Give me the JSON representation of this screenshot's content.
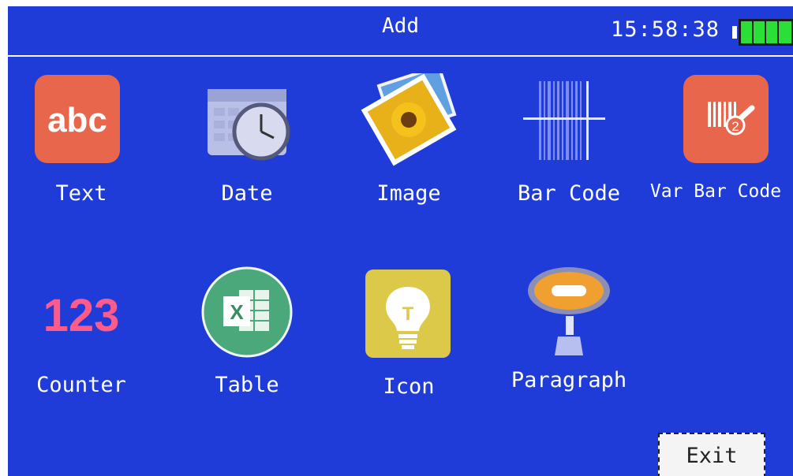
{
  "header": {
    "title": "Add",
    "time": "15:58:38",
    "battery_level": 1.0
  },
  "tiles": [
    {
      "label": "Text",
      "icon": "text-icon",
      "glyph": "abc"
    },
    {
      "label": "Date",
      "icon": "date-icon"
    },
    {
      "label": "Image",
      "icon": "image-icon"
    },
    {
      "label": "Bar Code",
      "icon": "barcode-icon"
    },
    {
      "label": "Var Bar Code",
      "icon": "var-barcode-icon",
      "glyph": "2"
    },
    {
      "label": "Counter",
      "icon": "counter-icon",
      "glyph": "123"
    },
    {
      "label": "Table",
      "icon": "table-icon",
      "glyph": "X"
    },
    {
      "label": "Icon",
      "icon": "lightbulb-icon",
      "glyph": "T"
    },
    {
      "label": "Paragraph",
      "icon": "paragraph-icon"
    }
  ],
  "footer": {
    "exit_label": "Exit"
  },
  "colors": {
    "background": "#1f3cd8",
    "battery": "#2cdf37",
    "text_icon": "#e8664b",
    "table_icon": "#4aa87a",
    "bulb_icon": "#dcc94a"
  }
}
